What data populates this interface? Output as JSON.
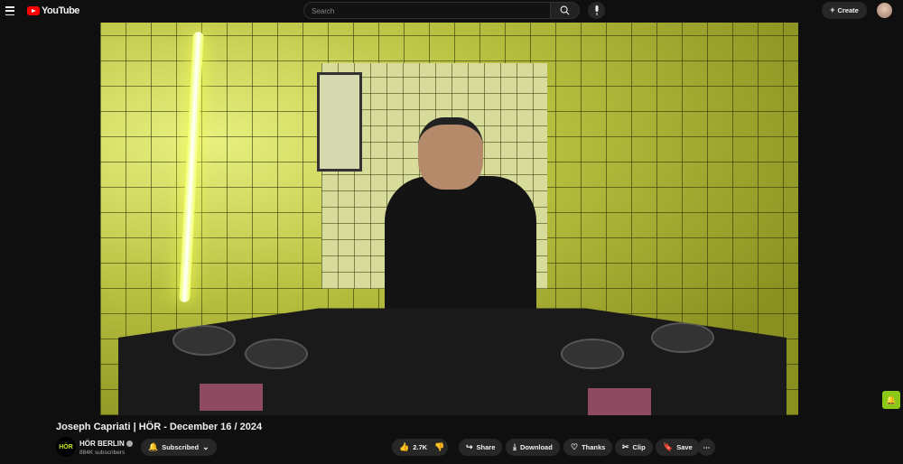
{
  "header": {
    "logo_text": "YouTube",
    "search_placeholder": "Search",
    "create_label": "Create"
  },
  "video": {
    "title": "Joseph Capriati | HÖR - December 16 / 2024"
  },
  "channel": {
    "logo_text": "HÖR",
    "name": "HÖR BERLIN",
    "subscribers": "884K subscribers",
    "subscribe_label": "Subscribed"
  },
  "actions": {
    "likes": "2.7K",
    "share": "Share",
    "download": "Download",
    "thanks": "Thanks",
    "clip": "Clip",
    "save": "Save",
    "more": "⋯"
  },
  "colors": {
    "brand": "#ff0000",
    "channel_accent": "#c8f020"
  }
}
